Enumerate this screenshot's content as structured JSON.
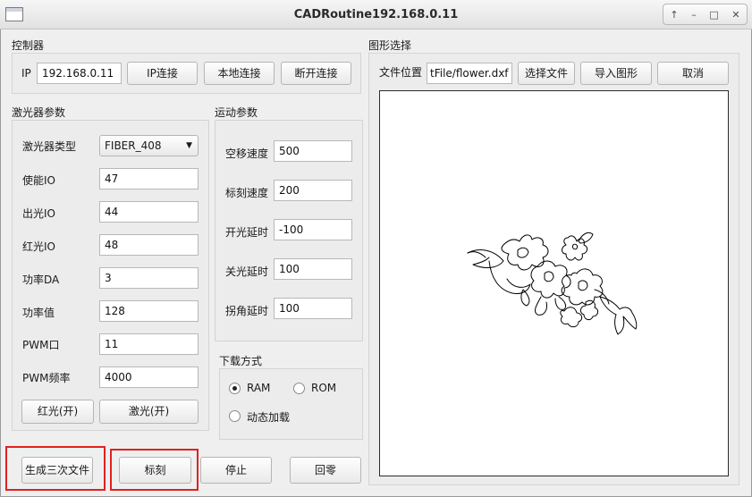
{
  "window": {
    "title": "CADRoutine192.168.0.11",
    "controls": [
      "↑",
      "–",
      "□",
      "✕"
    ]
  },
  "controller": {
    "title": "控制器",
    "ip_label": "IP",
    "ip_value": "192.168.0.11",
    "ip_connect": "IP连接",
    "local_connect": "本地连接",
    "disconnect": "断开连接"
  },
  "laser": {
    "title": "激光器参数",
    "type_label": "激光器类型",
    "type_value": "FIBER_408",
    "fields": [
      {
        "label": "使能IO",
        "value": "47"
      },
      {
        "label": "出光IO",
        "value": "44"
      },
      {
        "label": "红光IO",
        "value": "48"
      },
      {
        "label": "功率DA",
        "value": "3"
      },
      {
        "label": "功率值",
        "value": "128"
      },
      {
        "label": "PWM口",
        "value": "11"
      },
      {
        "label": "PWM频率",
        "value": "4000"
      }
    ],
    "red_light": "红光(开)",
    "laser_on": "激光(开)"
  },
  "motion": {
    "title": "运动参数",
    "fields": [
      {
        "label": "空移速度",
        "value": "500"
      },
      {
        "label": "标刻速度",
        "value": "200"
      },
      {
        "label": "开光延时",
        "value": "-100"
      },
      {
        "label": "关光延时",
        "value": "100"
      },
      {
        "label": "拐角延时",
        "value": "100"
      }
    ]
  },
  "download": {
    "title": "下载方式",
    "ram": "RAM",
    "rom": "ROM",
    "dynamic": "动态加载",
    "selected": "RAM"
  },
  "graphic": {
    "title": "图形选择",
    "file_label": "文件位置",
    "file_value": "tFile/flower.dxf",
    "choose_file": "选择文件",
    "import": "导入图形",
    "cancel": "取消"
  },
  "actions": {
    "gen3d": "生成三次文件",
    "mark": "标刻",
    "stop": "停止",
    "home": "回零"
  },
  "colors": {
    "highlight": "#e12020"
  }
}
